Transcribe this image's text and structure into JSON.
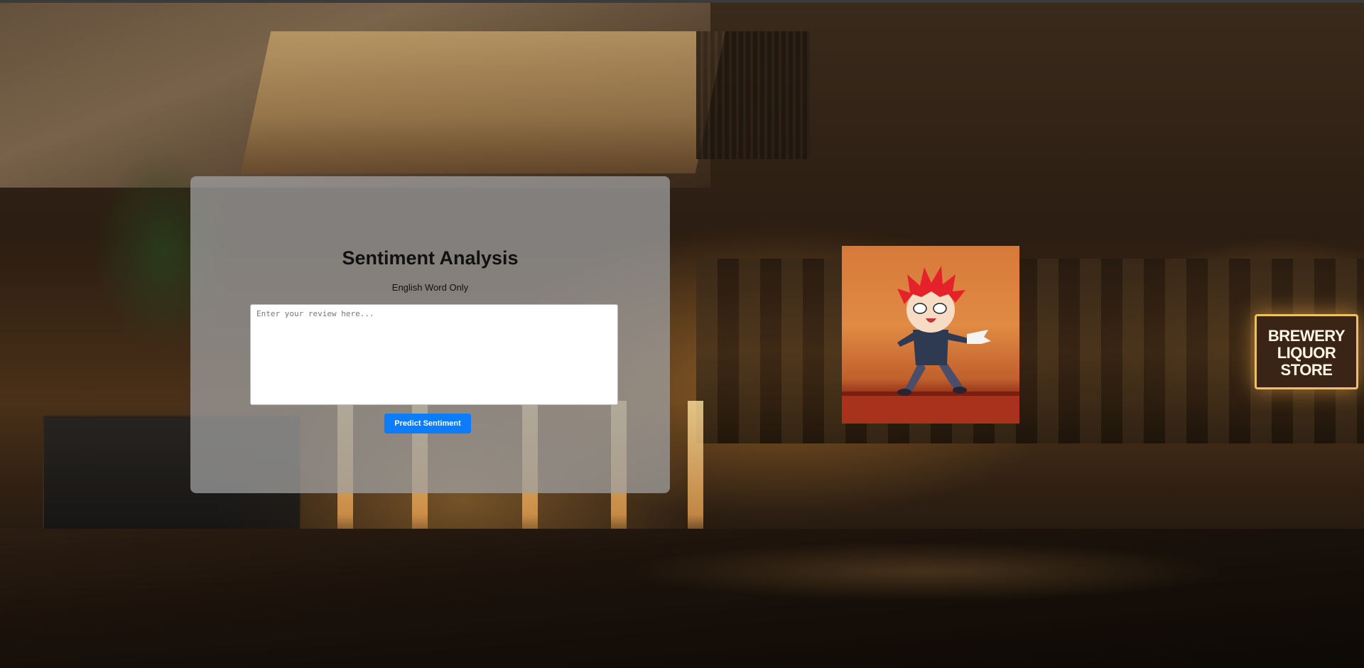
{
  "card": {
    "title": "Sentiment Analysis",
    "subtitle": "English Word Only",
    "review_placeholder": "Enter your review here...",
    "review_value": "",
    "predict_button_label": "Predict Sentiment"
  },
  "background": {
    "store_sign_lines": [
      "BREWERY",
      "LIQUOR",
      "STORE"
    ]
  },
  "colors": {
    "button": "#0b7dfa",
    "card_bg": "rgba(160,160,160,0.75)"
  },
  "icons": {
    "character": "anime-chibi-character"
  }
}
